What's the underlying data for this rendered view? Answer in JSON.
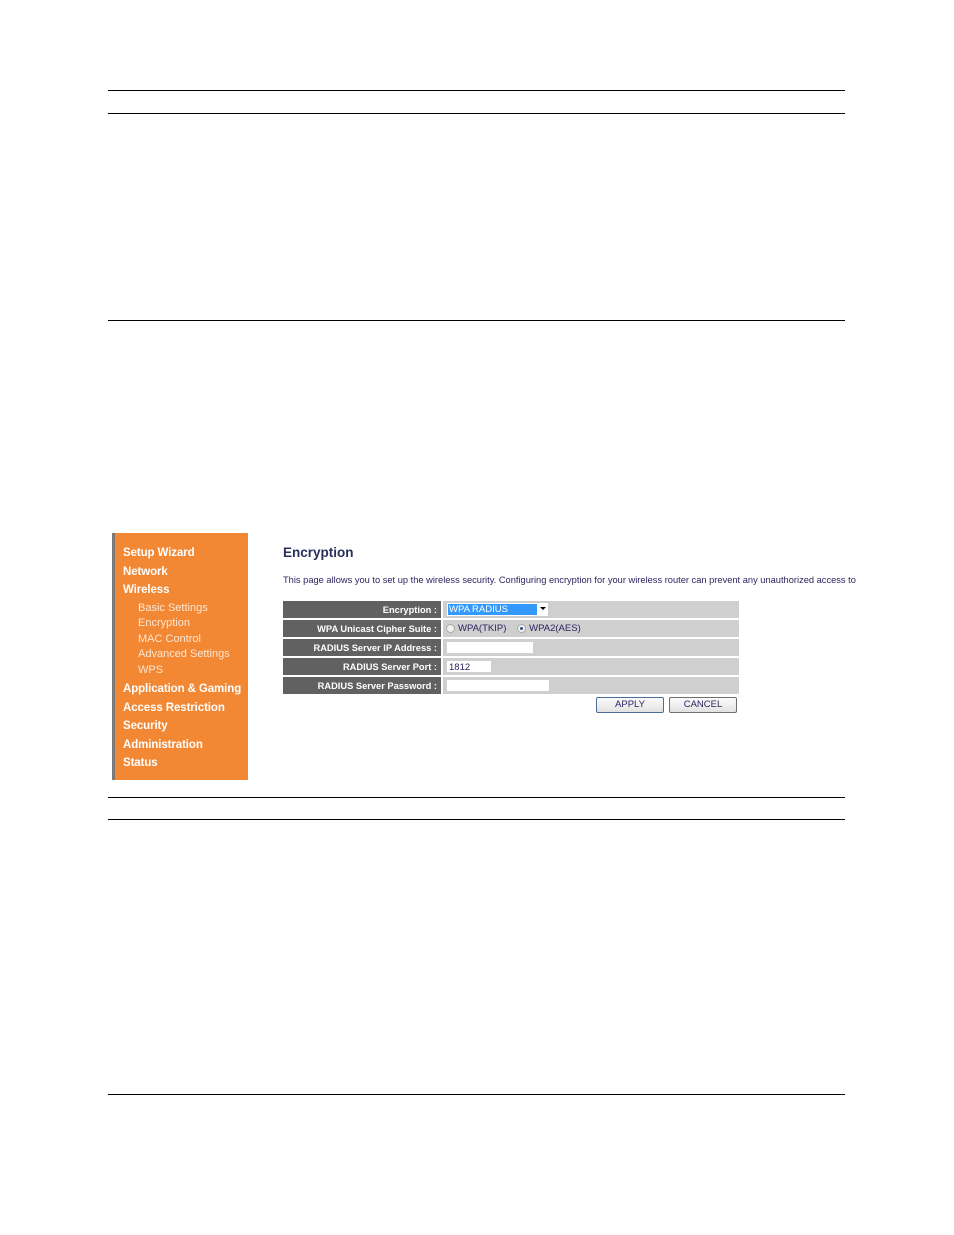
{
  "sidebar": {
    "items": [
      {
        "label": "Setup Wizard",
        "level": "main"
      },
      {
        "label": "Network",
        "level": "main"
      },
      {
        "label": "Wireless",
        "level": "main"
      },
      {
        "label": "Basic Settings",
        "level": "sub"
      },
      {
        "label": "Encryption",
        "level": "sub"
      },
      {
        "label": "MAC Control",
        "level": "sub"
      },
      {
        "label": "Advanced Settings",
        "level": "sub"
      },
      {
        "label": "WPS",
        "level": "sub"
      },
      {
        "label": "Application & Gaming",
        "level": "main"
      },
      {
        "label": "Access Restriction",
        "level": "main"
      },
      {
        "label": "Security",
        "level": "main"
      },
      {
        "label": "Administration",
        "level": "main"
      },
      {
        "label": "Status",
        "level": "main"
      }
    ],
    "color": "#f28734"
  },
  "main": {
    "title": "Encryption",
    "description": "This page allows you to set up the wireless security. Configuring encryption for your wireless router can prevent any unauthorized access to",
    "form": {
      "encryption": {
        "label": "Encryption :",
        "selected": "WPA RADIUS"
      },
      "cipher": {
        "label": "WPA Unicast Cipher Suite :",
        "options": [
          {
            "label": "WPA(TKIP)",
            "checked": false
          },
          {
            "label": "WPA2(AES)",
            "checked": true
          }
        ]
      },
      "radius_ip": {
        "label": "RADIUS Server IP Address :",
        "value": ""
      },
      "radius_port": {
        "label": "RADIUS Server Port :",
        "value": "1812"
      },
      "radius_password": {
        "label": "RADIUS Server Password :",
        "value": ""
      }
    },
    "buttons": {
      "apply": "APPLY",
      "cancel": "CANCEL"
    }
  }
}
